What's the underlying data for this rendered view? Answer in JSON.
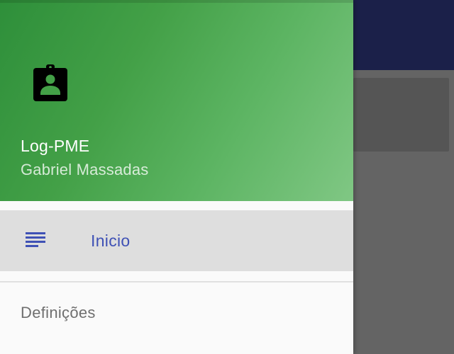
{
  "header": {
    "app_title": "Log-PME",
    "user_name": "Gabriel Massadas",
    "icon": "contact-badge-icon"
  },
  "menu": {
    "items": [
      {
        "label": "Inicio",
        "icon": "list-lines-icon",
        "active": true
      },
      {
        "label": "Definições",
        "active": false
      }
    ]
  },
  "colors": {
    "header_gradient_start": "#2e8f3a",
    "header_gradient_end": "#80c784",
    "accent": "#3f51b5",
    "active_item_bg": "#dedede",
    "background_toolbar": "#1b2049",
    "scrim": "#646464"
  }
}
